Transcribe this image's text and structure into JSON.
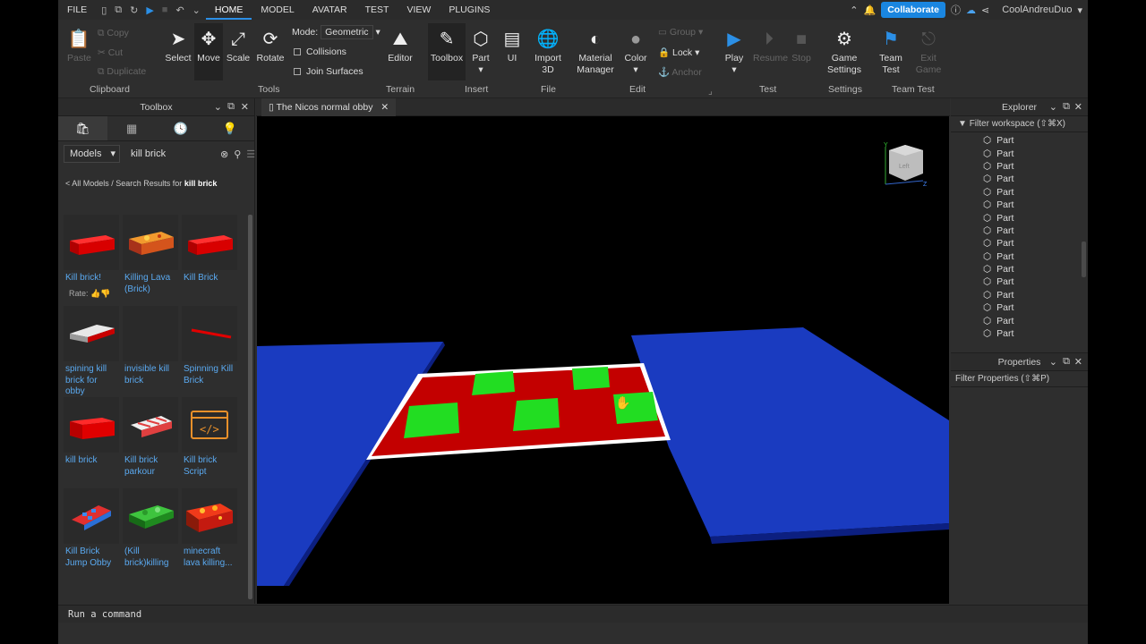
{
  "menu": {
    "items": [
      "FILE",
      "HOME",
      "MODEL",
      "AVATAR",
      "TEST",
      "VIEW",
      "PLUGINS"
    ],
    "active": "HOME"
  },
  "topright": {
    "collaborate": "Collaborate",
    "username": "CoolAndreuDuo"
  },
  "ribbon": {
    "clipboard": {
      "paste": "Paste",
      "copy": "Copy",
      "cut": "Cut",
      "duplicate": "Duplicate",
      "group": "Clipboard"
    },
    "tools": {
      "select": "Select",
      "move": "Move",
      "scale": "Scale",
      "rotate": "Rotate",
      "mode_label": "Mode:",
      "mode_value": "Geometric",
      "collisions": "Collisions",
      "join_surfaces": "Join Surfaces",
      "group": "Tools"
    },
    "terrain": {
      "editor": "Editor",
      "group": "Terrain"
    },
    "insert": {
      "toolbox": "Toolbox",
      "part": "Part",
      "ui": "UI",
      "group": "Insert"
    },
    "file": {
      "import": "Import\n3D",
      "group": "File"
    },
    "edit": {
      "material": "Material\nManager",
      "color": "Color",
      "group_btn": "Group",
      "lock": "Lock",
      "anchor": "Anchor",
      "group": "Edit"
    },
    "test": {
      "play": "Play",
      "resume": "Resume",
      "stop": "Stop",
      "group": "Test"
    },
    "settings": {
      "game_settings": "Game\nSettings",
      "group": "Settings"
    },
    "teamtest": {
      "team_test": "Team\nTest",
      "exit_game": "Exit\nGame",
      "group": "Team Test"
    }
  },
  "toolbox": {
    "title": "Toolbox",
    "category": "Models",
    "search": "kill brick",
    "crumb_prefix": "< All Models / Search Results for ",
    "crumb_term": "kill brick",
    "rate_label": "Rate:",
    "items": [
      {
        "label": "Kill brick!",
        "thumb": "red-brick"
      },
      {
        "label": "Killing Lava (Brick)",
        "thumb": "lava-brick"
      },
      {
        "label": "Kill Brick",
        "thumb": "red-brick"
      },
      {
        "label": "spining kill brick for obby",
        "thumb": "grey-brick"
      },
      {
        "label": "invisible kill brick",
        "thumb": "empty"
      },
      {
        "label": "Spinning Kill Brick",
        "thumb": "thin-red"
      },
      {
        "label": "kill brick",
        "thumb": "red-brick"
      },
      {
        "label": "Kill brick parkour",
        "thumb": "striped-brick"
      },
      {
        "label": "Kill brick Script",
        "thumb": "script-icon"
      },
      {
        "label": "Kill Brick Jump Obby",
        "thumb": "checker-brick"
      },
      {
        "label": "(Kill brick)killing",
        "thumb": "green-camo"
      },
      {
        "label": "minecraft lava killing...",
        "thumb": "lava-wedge"
      }
    ]
  },
  "document_tab": "The Nicos normal obby",
  "viewcube": {
    "face": "Left",
    "axis_y": "Y",
    "axis_z": "Z"
  },
  "explorer": {
    "title": "Explorer",
    "filter": "Filter workspace (⇧⌘X)",
    "rows": [
      "Part",
      "Part",
      "Part",
      "Part",
      "Part",
      "Part",
      "Part",
      "Part",
      "Part",
      "Part",
      "Part",
      "Part",
      "Part",
      "Part",
      "Part",
      "Part"
    ]
  },
  "properties": {
    "title": "Properties",
    "filter": "Filter Properties (⇧⌘P)"
  },
  "command_bar": "Run a command"
}
